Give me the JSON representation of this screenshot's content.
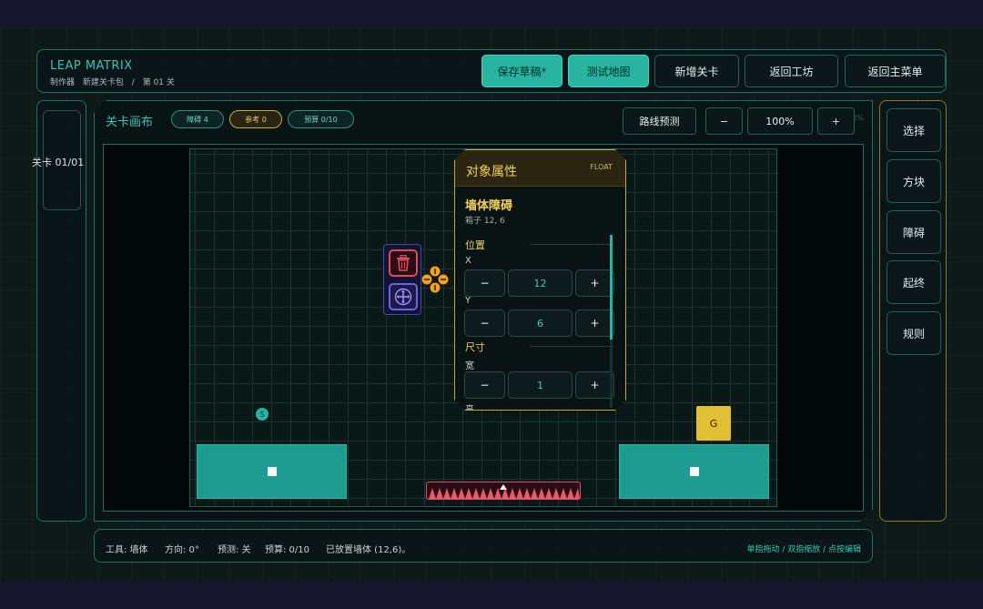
{
  "header": {
    "brand": "LEAP MATRIX",
    "crumb_role": "制作器",
    "crumb_pack": "新建关卡包",
    "crumb_sep": "/",
    "crumb_level": "第 01 关",
    "buttons": [
      "保存草稿*",
      "测试地图",
      "新增关卡",
      "返回工坊",
      "返回主菜单"
    ]
  },
  "left_sidebar": {
    "level_label": "关卡 01/01"
  },
  "canvas": {
    "title": "关卡画布",
    "chips": [
      "障碍 4",
      "参考 0",
      "预算 0/10"
    ],
    "path_preview": "路线预测",
    "zoom_out": "−",
    "zoom": "100%",
    "zoom_in": "+",
    "ghost_zoom": "100%"
  },
  "tools": [
    "选择",
    "方块",
    "障碍",
    "起终",
    "规则"
  ],
  "markers": {
    "start": "S",
    "goal": "G"
  },
  "properties": {
    "title": "对象属性",
    "tag": "FLOAT",
    "object_name": "墙体障碍",
    "object_sub": "箱子 12, 6",
    "section_position": "位置",
    "label_x": "X",
    "value_x": "12",
    "label_y": "Y",
    "value_y": "6",
    "section_size": "尺寸",
    "label_width": "宽",
    "value_width": "1",
    "label_height": "高",
    "minus": "−",
    "plus": "+"
  },
  "status": {
    "tool": "工具: 墙体",
    "direction": "方向: 0°",
    "prediction": "预测: 关",
    "budget": "预算: 0/10",
    "message": "已放置墙体 (12,6)。",
    "hint": "单指拖动 / 双指缩放 / 点按编辑"
  },
  "colors": {
    "accent": "#27b5a2",
    "gold": "#e2bf35",
    "danger": "#e04a5a",
    "move": "#6e63e6",
    "background": "#0d1a18"
  }
}
